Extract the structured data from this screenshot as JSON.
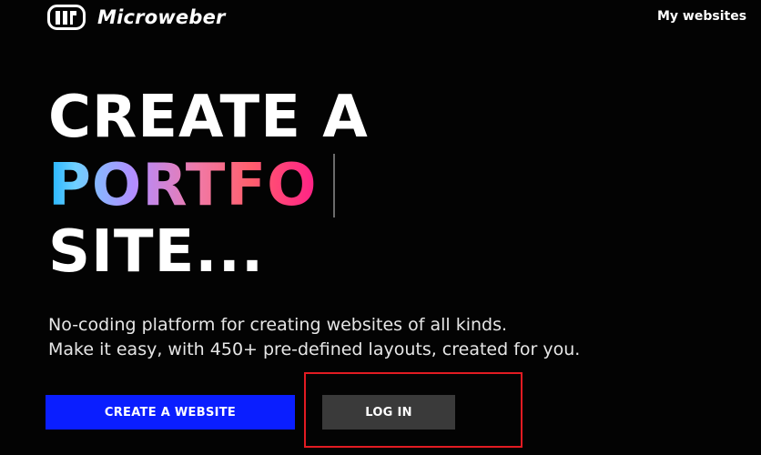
{
  "header": {
    "logo_text": "Microweber",
    "logo_icon": "microweber-logo-icon",
    "nav_link": "My websites"
  },
  "hero": {
    "line1": "CREATE A",
    "line2": "PORTFO",
    "line3": "SITE...",
    "gradient_colors": [
      "#1fb3ff",
      "#b38cff",
      "#ff5f6d",
      "#ff1f87"
    ]
  },
  "subtext": {
    "line1": "No-coding platform for creating websites of all kinds.",
    "line2": "Make it easy, with 450+ pre-defined layouts, created for you."
  },
  "buttons": {
    "create_label": "CREATE A WEBSITE",
    "login_label": "LOG IN"
  },
  "colors": {
    "background": "#030303",
    "primary_button": "#0a1eff",
    "secondary_button": "#3a3a3a",
    "highlight": "#e21b22"
  }
}
